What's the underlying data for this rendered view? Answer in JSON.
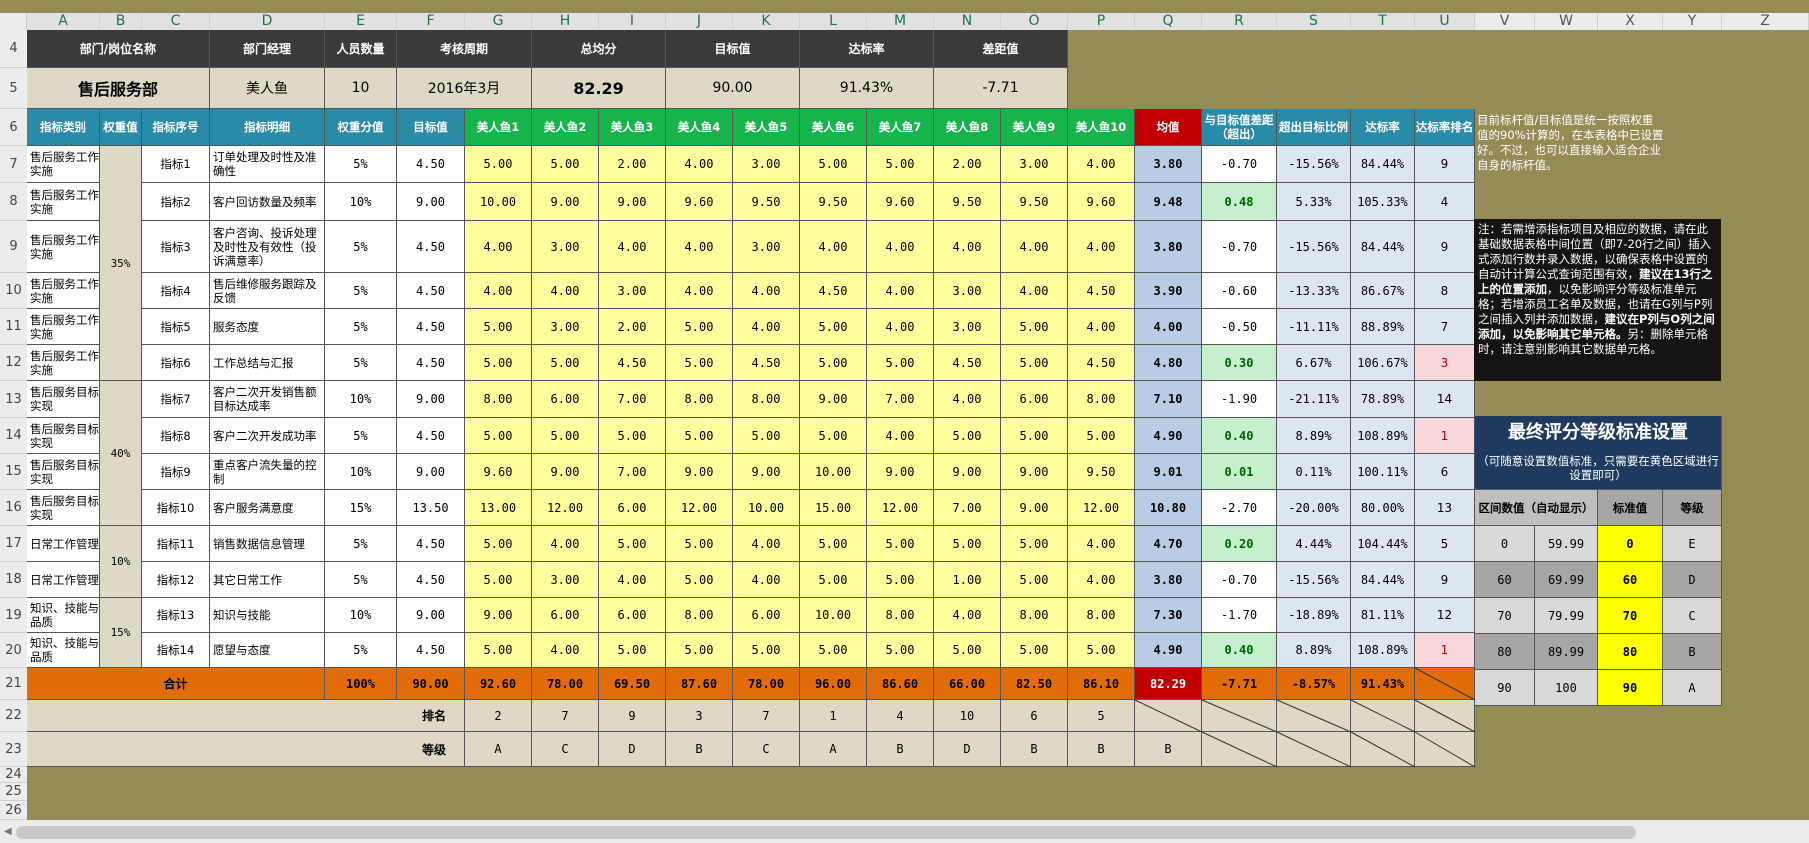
{
  "columns": [
    "A",
    "B",
    "C",
    "D",
    "E",
    "F",
    "G",
    "H",
    "I",
    "J",
    "K",
    "L",
    "M",
    "N",
    "O",
    "P",
    "Q",
    "R",
    "S",
    "T",
    "U",
    "V",
    "W",
    "X",
    "Y",
    "Z"
  ],
  "rows": [
    "4",
    "5",
    "6",
    "7",
    "8",
    "9",
    "10",
    "11",
    "12",
    "13",
    "14",
    "15",
    "16",
    "17",
    "18",
    "19",
    "20",
    "21",
    "22",
    "23",
    "24",
    "25",
    "26"
  ],
  "summary": {
    "headers": [
      "部门/岗位名称",
      "部门经理",
      "人员数量",
      "考核周期",
      "总均分",
      "目标值",
      "达标率",
      "差距值"
    ],
    "values": [
      "售后服务部",
      "美人鱼",
      "10",
      "2016年3月",
      "82.29",
      "90.00",
      "91.43%",
      "-7.71"
    ]
  },
  "table_headers": [
    "指标类别",
    "权重值",
    "指标序号",
    "指标明细",
    "权重分值",
    "目标值",
    "美人鱼1",
    "美人鱼2",
    "美人鱼3",
    "美人鱼4",
    "美人鱼5",
    "美人鱼6",
    "美人鱼7",
    "美人鱼8",
    "美人鱼9",
    "美人鱼10",
    "均值",
    "与目标值差距（超出）",
    "超出目标比例",
    "达标率",
    "达标率排名"
  ],
  "weights": [
    "35%",
    "40%",
    "10%",
    "15%"
  ],
  "rows_data": [
    {
      "cat": "售后服务工作实施",
      "no": "指标1",
      "detail": "订单处理及时性及准确性",
      "w": "5%",
      "target": "4.50",
      "s": [
        "5.00",
        "5.00",
        "2.00",
        "4.00",
        "3.00",
        "5.00",
        "5.00",
        "2.00",
        "3.00",
        "4.00"
      ],
      "avg": "3.80",
      "gap": "-0.70",
      "ratio": "-15.56%",
      "rate": "84.44%",
      "rank": "9"
    },
    {
      "cat": "售后服务工作实施",
      "no": "指标2",
      "detail": "客户回访数量及频率",
      "w": "10%",
      "target": "9.00",
      "s": [
        "10.00",
        "9.00",
        "9.00",
        "9.60",
        "9.50",
        "9.50",
        "9.60",
        "9.50",
        "9.50",
        "9.60"
      ],
      "avg": "9.48",
      "gap": "0.48",
      "ratio": "5.33%",
      "rate": "105.33%",
      "rank": "4"
    },
    {
      "cat": "售后服务工作实施",
      "no": "指标3",
      "detail": "客户咨询、投诉处理及时性及有效性（投诉满意率）",
      "w": "5%",
      "target": "4.50",
      "s": [
        "4.00",
        "3.00",
        "4.00",
        "4.00",
        "3.00",
        "4.00",
        "4.00",
        "4.00",
        "4.00",
        "4.00"
      ],
      "avg": "3.80",
      "gap": "-0.70",
      "ratio": "-15.56%",
      "rate": "84.44%",
      "rank": "9"
    },
    {
      "cat": "售后服务工作实施",
      "no": "指标4",
      "detail": "售后维修服务跟踪及反馈",
      "w": "5%",
      "target": "4.50",
      "s": [
        "4.00",
        "4.00",
        "3.00",
        "4.00",
        "4.00",
        "4.50",
        "4.00",
        "3.00",
        "4.00",
        "4.50"
      ],
      "avg": "3.90",
      "gap": "-0.60",
      "ratio": "-13.33%",
      "rate": "86.67%",
      "rank": "8"
    },
    {
      "cat": "售后服务工作实施",
      "no": "指标5",
      "detail": "服务态度",
      "w": "5%",
      "target": "4.50",
      "s": [
        "5.00",
        "3.00",
        "2.00",
        "5.00",
        "4.00",
        "5.00",
        "4.00",
        "3.00",
        "5.00",
        "4.00"
      ],
      "avg": "4.00",
      "gap": "-0.50",
      "ratio": "-11.11%",
      "rate": "88.89%",
      "rank": "7"
    },
    {
      "cat": "售后服务工作实施",
      "no": "指标6",
      "detail": "工作总结与汇报",
      "w": "5%",
      "target": "4.50",
      "s": [
        "5.00",
        "5.00",
        "4.50",
        "5.00",
        "4.50",
        "5.00",
        "5.00",
        "4.50",
        "5.00",
        "4.50"
      ],
      "avg": "4.80",
      "gap": "0.30",
      "ratio": "6.67%",
      "rate": "106.67%",
      "rank": "3"
    },
    {
      "cat": "售后服务目标实现",
      "no": "指标7",
      "detail": "客户二次开发销售额目标达成率",
      "w": "10%",
      "target": "9.00",
      "s": [
        "8.00",
        "6.00",
        "7.00",
        "8.00",
        "8.00",
        "9.00",
        "7.00",
        "4.00",
        "6.00",
        "8.00"
      ],
      "avg": "7.10",
      "gap": "-1.90",
      "ratio": "-21.11%",
      "rate": "78.89%",
      "rank": "14"
    },
    {
      "cat": "售后服务目标实现",
      "no": "指标8",
      "detail": "客户二次开发成功率",
      "w": "5%",
      "target": "4.50",
      "s": [
        "5.00",
        "5.00",
        "5.00",
        "5.00",
        "5.00",
        "5.00",
        "4.00",
        "5.00",
        "5.00",
        "5.00"
      ],
      "avg": "4.90",
      "gap": "0.40",
      "ratio": "8.89%",
      "rate": "108.89%",
      "rank": "1"
    },
    {
      "cat": "售后服务目标实现",
      "no": "指标9",
      "detail": "重点客户流失量的控制",
      "w": "10%",
      "target": "9.00",
      "s": [
        "9.60",
        "9.00",
        "7.00",
        "9.00",
        "9.00",
        "10.00",
        "9.00",
        "9.00",
        "9.00",
        "9.50"
      ],
      "avg": "9.01",
      "gap": "0.01",
      "ratio": "0.11%",
      "rate": "100.11%",
      "rank": "6"
    },
    {
      "cat": "售后服务目标实现",
      "no": "指标10",
      "detail": "客户服务满意度",
      "w": "15%",
      "target": "13.50",
      "s": [
        "13.00",
        "12.00",
        "6.00",
        "12.00",
        "10.00",
        "15.00",
        "12.00",
        "7.00",
        "9.00",
        "12.00"
      ],
      "avg": "10.80",
      "gap": "-2.70",
      "ratio": "-20.00%",
      "rate": "80.00%",
      "rank": "13"
    },
    {
      "cat": "日常工作管理",
      "no": "指标11",
      "detail": "销售数据信息管理",
      "w": "5%",
      "target": "4.50",
      "s": [
        "5.00",
        "4.00",
        "5.00",
        "5.00",
        "4.00",
        "5.00",
        "5.00",
        "5.00",
        "5.00",
        "4.00"
      ],
      "avg": "4.70",
      "gap": "0.20",
      "ratio": "4.44%",
      "rate": "104.44%",
      "rank": "5"
    },
    {
      "cat": "日常工作管理",
      "no": "指标12",
      "detail": "其它日常工作",
      "w": "5%",
      "target": "4.50",
      "s": [
        "5.00",
        "3.00",
        "4.00",
        "5.00",
        "4.00",
        "5.00",
        "5.00",
        "1.00",
        "5.00",
        "4.00"
      ],
      "avg": "3.80",
      "gap": "-0.70",
      "ratio": "-15.56%",
      "rate": "84.44%",
      "rank": "9"
    },
    {
      "cat": "知识、技能与品质",
      "no": "指标13",
      "detail": "知识与技能",
      "w": "10%",
      "target": "9.00",
      "s": [
        "9.00",
        "6.00",
        "6.00",
        "8.00",
        "6.00",
        "10.00",
        "8.00",
        "4.00",
        "8.00",
        "8.00"
      ],
      "avg": "7.30",
      "gap": "-1.70",
      "ratio": "-18.89%",
      "rate": "81.11%",
      "rank": "12"
    },
    {
      "cat": "知识、技能与品质",
      "no": "指标14",
      "detail": "愿望与态度",
      "w": "5%",
      "target": "4.50",
      "s": [
        "5.00",
        "4.00",
        "5.00",
        "5.00",
        "5.00",
        "5.00",
        "5.00",
        "5.00",
        "5.00",
        "5.00"
      ],
      "avg": "4.90",
      "gap": "0.40",
      "ratio": "8.89%",
      "rate": "108.89%",
      "rank": "1"
    }
  ],
  "total": {
    "label": "合计",
    "w": "100%",
    "target": "90.00",
    "s": [
      "92.60",
      "78.00",
      "69.50",
      "87.60",
      "78.00",
      "96.00",
      "86.60",
      "66.00",
      "82.50",
      "86.10"
    ],
    "avg": "82.29",
    "gap": "-7.71",
    "ratio": "-8.57%",
    "rate": "91.43%"
  },
  "rank_row": {
    "label": "排名",
    "values": [
      "2",
      "7",
      "9",
      "3",
      "7",
      "1",
      "4",
      "10",
      "6",
      "5"
    ]
  },
  "grade_row": {
    "label": "等级",
    "values": [
      "A",
      "C",
      "D",
      "B",
      "C",
      "A",
      "B",
      "D",
      "B",
      "B",
      "B"
    ]
  },
  "note1": "目前标杆值/目标值是统一按照权重值的90%计算的，在本表格中已设置好。不过，也可以直接输入适合企业自身的标杆值。",
  "note2": {
    "p1": "注：若需增添指标项目及相应的数据，请在此基础数据表格中间位置（即7-20行之间）插入式添加行数并录入数据，以确保表格中设置的自动计计算公式查询范围有效，",
    "b1": "建议在13行之上的位置添加",
    "p2": "，以免影响评分等级标准单元格；若增添员工名单及数据，也请在G列与P列之间插入列并添加数据，",
    "b2": "建议在P列与O列之间添加，以免影响其它单元格。",
    "p3": "另：删除单元格时，请注意别影响其它数据单元格。"
  },
  "grade_settings": {
    "title": "最终评分等级标准设置",
    "subtitle": "（可随意设置数值标准，只需要在黄色区域进行设置即可）",
    "headers": [
      "区间数值（自动显示）",
      "标准值",
      "等级"
    ],
    "rows": [
      [
        "0",
        "59.99",
        "0",
        "E"
      ],
      [
        "60",
        "69.99",
        "60",
        "D"
      ],
      [
        "70",
        "79.99",
        "70",
        "C"
      ],
      [
        "80",
        "89.99",
        "80",
        "B"
      ],
      [
        "90",
        "100",
        "90",
        "A"
      ]
    ]
  },
  "colors": {
    "dark_header": "#3A3A3A",
    "teal": "#2A8BA8",
    "green": "#17B34B",
    "yellow": "#FFFF9E",
    "red": "#C00000",
    "orange": "#E26B0A",
    "beige": "#DDD9C4",
    "navy": "#1F3A5F",
    "olive": "#958B55",
    "bright_yellow": "#FFFF00"
  }
}
